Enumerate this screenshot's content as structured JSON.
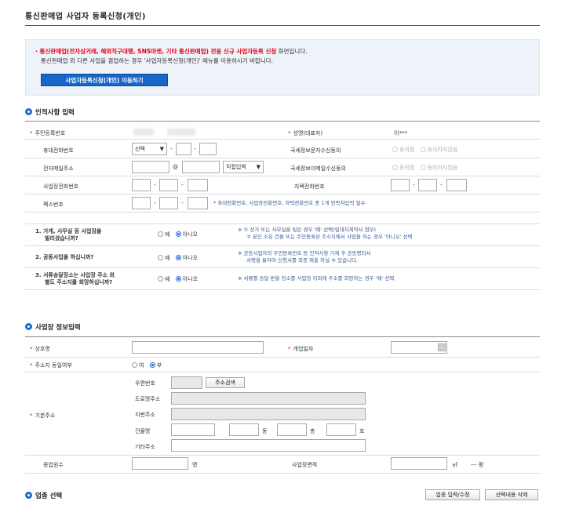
{
  "title": "통신판매업 사업자 등록신청(개인)",
  "notice": {
    "line1_red": "통신판매업(전자상거래, 해외직구대행, SNS마켓, 기타 통신판매업) 전용 신규 사업자등록 신청",
    "line1_rest": " 화면입니다.",
    "line2": "통신판매업 외 다른 사업을 겸업하는 경우 '사업자등록신청(개인)' 메뉴를 이용하시기 바랍니다.",
    "button": "사업자등록신청(개인) 이동하기"
  },
  "personal": {
    "heading": "인적사항 입력",
    "rrn_label": "주민등록번호",
    "name_label": "성명(대표자)",
    "name_value": "이***",
    "mobile_label": "휴대전화번호",
    "mobile_select": "선택",
    "sms_label": "국세정보문자수신동의",
    "email_label": "전자메일주소",
    "email_at": "@",
    "email_select": "직접입력",
    "email_consent_label": "국세정보이메일수신동의",
    "agree": "동의함",
    "disagree": "동의하지않음",
    "office_phone_label": "사업장전화번호",
    "home_phone_label": "자택전화번호",
    "fax_label": "팩스번호",
    "phone_note": "* 휴대전화번호, 사업장전화번호, 자택전화번호 중 1개 연락처입력 필수"
  },
  "questions": [
    {
      "q": [
        "1. 가게, 사무실 등 사업장을",
        "빌리셨습니까?"
      ],
      "yes": "예",
      "no": "아니오",
      "note": [
        "※ ① 상가 또는 사무실을 빌린 경우 '예' 선택(임대차계약서 첨부)",
        "② 본인 소유 건물 또는 주민등록상 주소지에서 사업을 하는 경우 '아니오' 선택"
      ]
    },
    {
      "q": [
        "2. 공동사업을 하십니까?"
      ],
      "yes": "예",
      "no": "아니오",
      "note": [
        "※ 공동사업자의 주민등록번호 등 인적사항 기재 후 공동명의서",
        "서명을 통하여 신청서를 최종 제출 하실 수 있습니다."
      ]
    },
    {
      "q": [
        "3. 서류송달장소는 사업장 주소 외",
        "별도 주소지를 희망하십니까?"
      ],
      "yes": "예",
      "no": "아니오",
      "note": [
        "※ 서류를 송달 받을 장소를 사업장 이외에 주소를 희망하는 경우 '예' 선택"
      ]
    }
  ],
  "business": {
    "heading": "사업장 정보입력",
    "trade_name_label": "상호명",
    "open_date_label": "개업일자",
    "same_address_label": "주소지 동일여부",
    "yes": "여",
    "no": "부",
    "address_label": "기본주소",
    "postal_label": "우편번호",
    "address_search": "주소검색",
    "road_label": "도로명주소",
    "jibun_label": "지번주소",
    "building_label": "건물명",
    "dong": "동",
    "floor": "층",
    "ho": "호",
    "other_label": "기타주소",
    "employees_label": "종업원수",
    "employees_unit": "명",
    "area_label": "사업장면적",
    "area_unit": "㎡",
    "area_pyeong": "--- 평"
  },
  "industry": {
    "heading": "업종 선택",
    "input_button": "업종 입력/수정",
    "delete_button": "선택내용 삭제"
  }
}
